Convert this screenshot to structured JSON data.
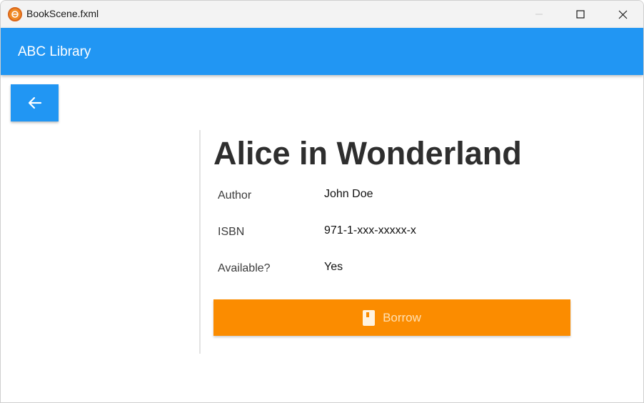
{
  "window": {
    "title": "BookScene.fxml",
    "icon": "app-logo-icon"
  },
  "appbar": {
    "title": "ABC Library",
    "color": "#2196f3"
  },
  "back_button": {
    "icon": "arrow-left-icon"
  },
  "book": {
    "title": "Alice in Wonderland",
    "fields": [
      {
        "label": "Author",
        "value": "John Doe"
      },
      {
        "label": "ISBN",
        "value": "971-1-xxx-xxxxx-x"
      },
      {
        "label": "Available?",
        "value": "Yes"
      }
    ]
  },
  "borrow_button": {
    "label": "Borrow",
    "icon": "book-icon",
    "color": "#fb8c00"
  }
}
